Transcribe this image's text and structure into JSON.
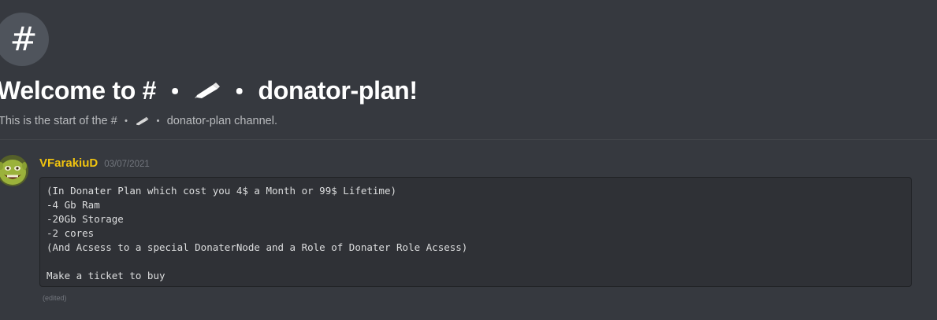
{
  "channel": {
    "icon": "#",
    "welcome_prefix": "Welcome to #",
    "separator": "・",
    "name_suffix": "donator-plan!",
    "subtitle_prefix": "This is the start of the #",
    "subtitle_suffix": "donator-plan channel.",
    "emoji": "pencil-icon"
  },
  "message": {
    "username": "VFarakiuD",
    "username_color": "#f1c40f",
    "timestamp": "03/07/2021",
    "lines": [
      "(In Donater Plan which cost you 4$ a Month or 99$ Lifetime)",
      "-4 Gb Ram",
      "-20Gb Storage",
      "-2 cores",
      "(And Acsess to a special DonaterNode and a Role of Donater Role Acsess)",
      "",
      "Make a ticket to buy"
    ],
    "edited_label": "(edited)"
  }
}
